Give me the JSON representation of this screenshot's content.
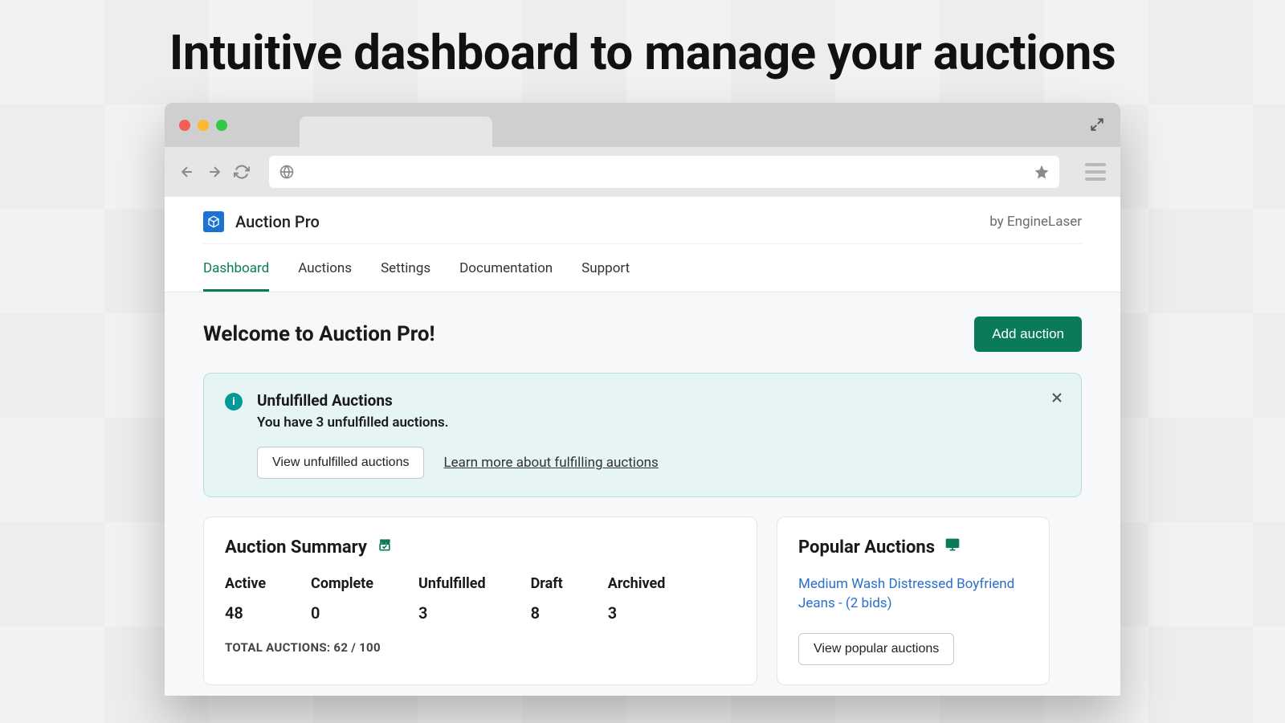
{
  "headline": "Intuitive dashboard to manage your auctions",
  "appbar": {
    "brand_name": "Auction Pro",
    "byline": "by EngineLaser"
  },
  "nav": {
    "tabs": [
      "Dashboard",
      "Auctions",
      "Settings",
      "Documentation",
      "Support"
    ]
  },
  "page": {
    "title": "Welcome to Auction Pro!",
    "primary_button": "Add auction"
  },
  "alert": {
    "title": "Unfulfilled Auctions",
    "body": "You have 3 unfulfilled auctions.",
    "action_button": "View unfulfilled auctions",
    "action_link": "Learn more about fulfilling auctions"
  },
  "summary": {
    "title": "Auction Summary",
    "stats": [
      {
        "label": "Active",
        "value": "48"
      },
      {
        "label": "Complete",
        "value": "0"
      },
      {
        "label": "Unfulfilled",
        "value": "3"
      },
      {
        "label": "Draft",
        "value": "8"
      },
      {
        "label": "Archived",
        "value": "3"
      }
    ],
    "total": "TOTAL AUCTIONS: 62 / 100"
  },
  "popular": {
    "title": "Popular Auctions",
    "items": [
      "Medium Wash Distressed Boyfriend Jeans - (2 bids)"
    ],
    "button": "View popular auctions"
  }
}
